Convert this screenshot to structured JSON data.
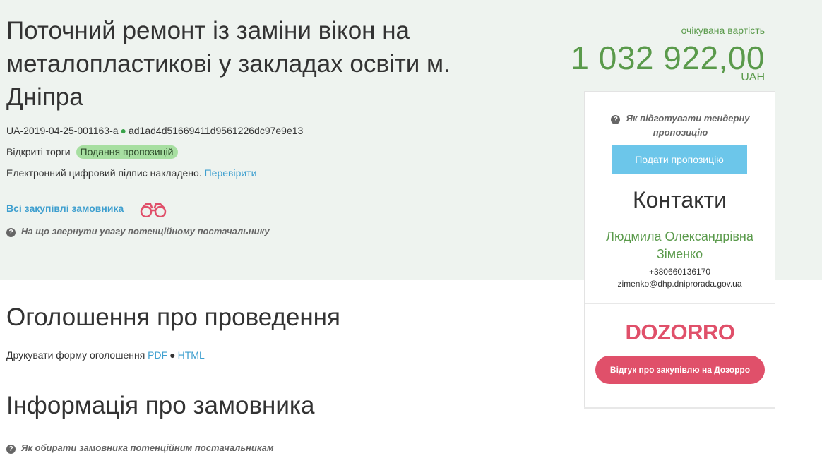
{
  "tender": {
    "title": "Поточний ремонт із заміни вікон на металопластикові у закладах освіти м. Дніпра",
    "id": "UA-2019-04-25-001163-a",
    "hash": "ad1ad4d51669411d9561226dc97e9e13",
    "procedure": "Відкриті торги",
    "status": "Подання пропозицій",
    "signature_text": "Електронний цифровий підпис накладено.",
    "signature_link": "Перевірити",
    "customer_purchases_link": "Всі закупівлі замовника",
    "supplier_hint": "На що звернути увагу потенційному постачальнику"
  },
  "price": {
    "label": "очікувана вартість",
    "value": "1 032 922,00",
    "currency": "UAH"
  },
  "panel": {
    "prepare_hint": "Як підготувати тендерну пропозицію",
    "submit_label": "Подати пропозицію",
    "contacts_title": "Контакти",
    "contact_name": "Людмила Олександрівна Зіменко",
    "contact_phone": "+380660136170",
    "contact_email": "zimenko@dhp.dniprorada.gov.ua",
    "dozorro_logo": "DOZORRO",
    "dozorro_button": "Відгук про закупівлю на Дозорро"
  },
  "sections": {
    "announcement_title": "Оголошення про проведення",
    "print_label": "Друкувати форму оголошення",
    "print_pdf": "PDF",
    "print_html": "HTML",
    "customer_title": "Інформація про замовника",
    "customer_hint": "Як обирати замовника потенційним постачальникам"
  },
  "colors": {
    "hero_bg": "#eef3ef",
    "accent_green": "#5a9a4b",
    "link_blue": "#3e9fcf",
    "submit_blue": "#6cc6ea",
    "dozorro_red": "#e0506a",
    "status_green": "#a7dfa1"
  },
  "icons": {
    "hint": "question-circle-icon",
    "customer_purchases": "binoculars-icon",
    "id_separator": "green-dot-icon"
  }
}
